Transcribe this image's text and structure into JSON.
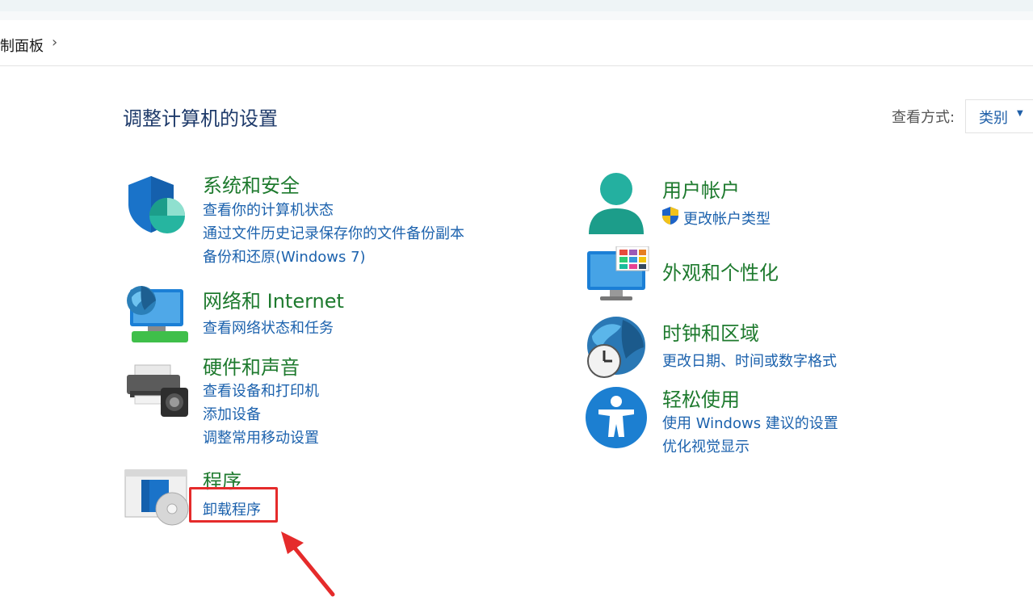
{
  "breadcrumb": {
    "item": "制面板",
    "sep": "›"
  },
  "header": {
    "title": "调整计算机的设置"
  },
  "view": {
    "label": "查看方式:",
    "value": "类别"
  },
  "categories": {
    "system_security": {
      "title": "系统和安全",
      "links": [
        "查看你的计算机状态",
        "通过文件历史记录保存你的文件备份副本",
        "备份和还原(Windows 7)"
      ]
    },
    "network": {
      "title": "网络和 Internet",
      "links": [
        "查看网络状态和任务"
      ]
    },
    "hardware": {
      "title": "硬件和声音",
      "links": [
        "查看设备和打印机",
        "添加设备",
        "调整常用移动设置"
      ]
    },
    "programs": {
      "title": "程序",
      "links": [
        "卸载程序"
      ]
    },
    "user_accounts": {
      "title": "用户帐户",
      "links": [
        "更改帐户类型"
      ]
    },
    "appearance": {
      "title": "外观和个性化",
      "links": []
    },
    "clock_region": {
      "title": "时钟和区域",
      "links": [
        "更改日期、时间或数字格式"
      ]
    },
    "ease_of_access": {
      "title": "轻松使用",
      "links": [
        "使用 Windows 建议的设置",
        "优化视觉显示"
      ]
    }
  },
  "colors": {
    "title_green": "#1e7a2e",
    "link_blue": "#1c62ad",
    "highlight_red": "#e52b2b"
  }
}
